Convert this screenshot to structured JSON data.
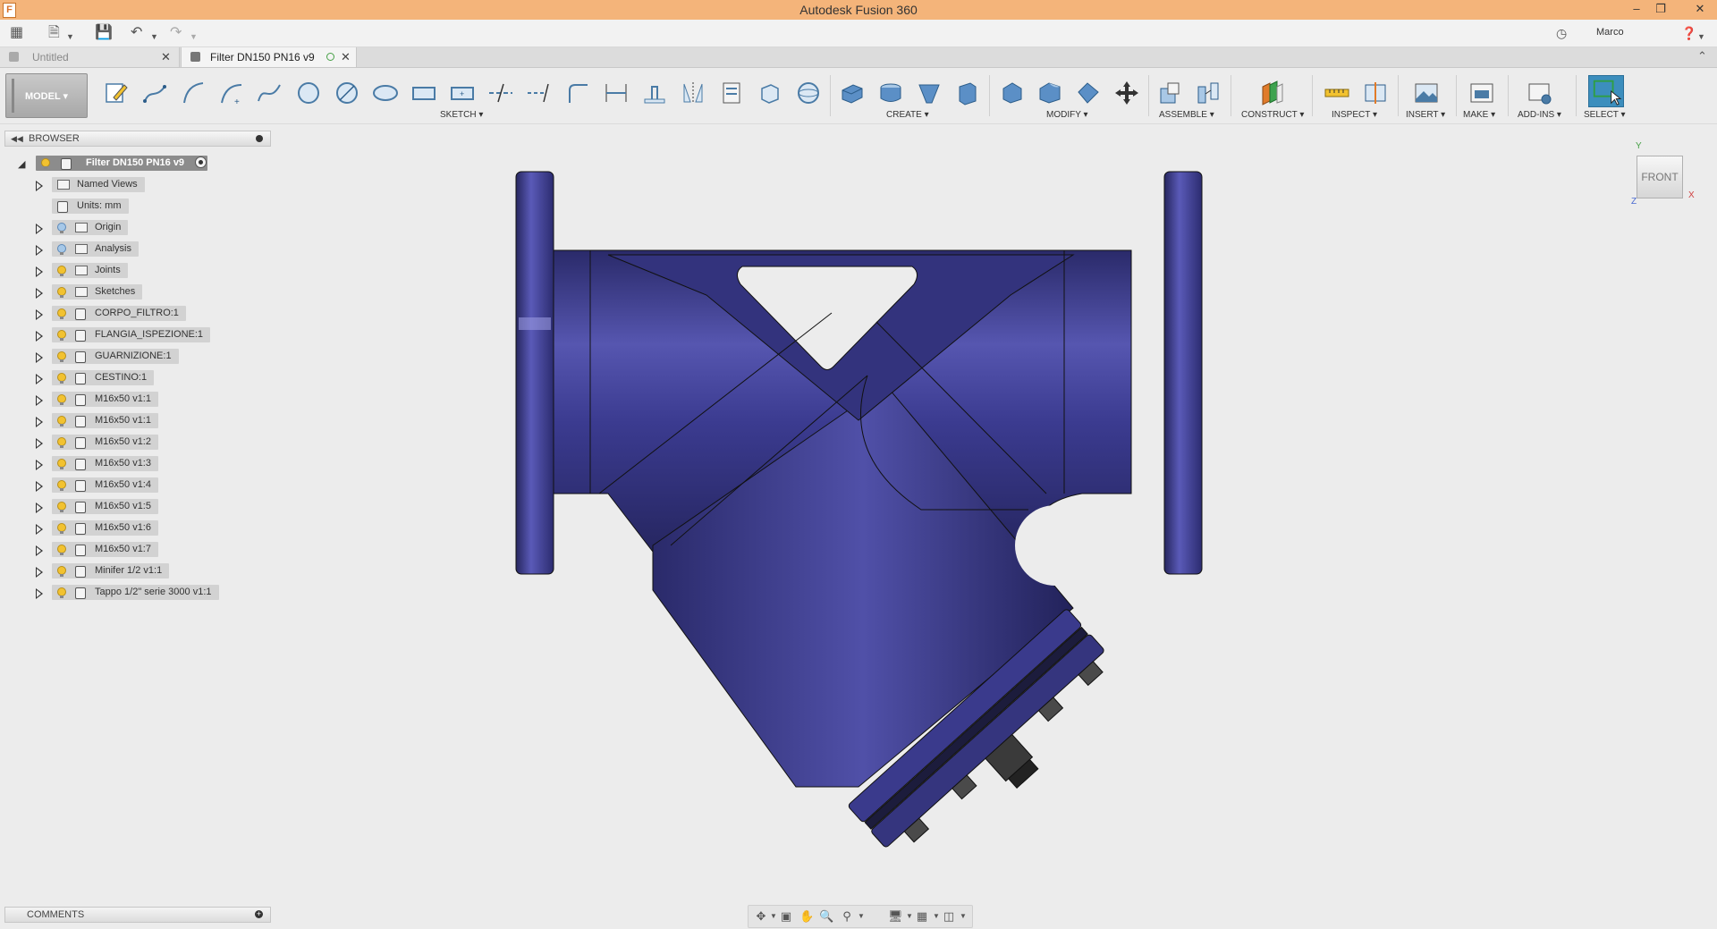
{
  "window": {
    "title": "Autodesk Fusion 360",
    "user": "Marco"
  },
  "tabs": [
    {
      "label": "Untitled",
      "active": false
    },
    {
      "label": "Filter DN150 PN16 v9",
      "active": true
    }
  ],
  "ribbon": {
    "workspace": "MODEL",
    "groups": {
      "sketch": "SKETCH",
      "create": "CREATE",
      "modify": "MODIFY",
      "assemble": "ASSEMBLE",
      "construct": "CONSTRUCT",
      "inspect": "INSPECT",
      "insert": "INSERT",
      "make": "MAKE",
      "addins": "ADD-INS",
      "select": "SELECT"
    }
  },
  "browser": {
    "title": "BROWSER",
    "root": "Filter DN150 PN16 v9",
    "items": [
      {
        "label": "Named Views",
        "type": "folder",
        "bulb": "none",
        "expandable": true
      },
      {
        "label": "Units: mm",
        "type": "doc",
        "bulb": "none",
        "expandable": false
      },
      {
        "label": "Origin",
        "type": "folder",
        "bulb": "blue",
        "expandable": true
      },
      {
        "label": "Analysis",
        "type": "folder",
        "bulb": "blue",
        "expandable": true
      },
      {
        "label": "Joints",
        "type": "folder",
        "bulb": "yellow",
        "expandable": true
      },
      {
        "label": "Sketches",
        "type": "folder",
        "bulb": "yellow",
        "expandable": true
      },
      {
        "label": "CORPO_FILTRO:1",
        "type": "component",
        "bulb": "yellow",
        "expandable": true
      },
      {
        "label": "FLANGIA_ISPEZIONE:1",
        "type": "component",
        "bulb": "yellow",
        "expandable": true
      },
      {
        "label": "GUARNIZIONE:1",
        "type": "component",
        "bulb": "yellow",
        "expandable": true
      },
      {
        "label": "CESTINO:1",
        "type": "component",
        "bulb": "yellow",
        "expandable": true
      },
      {
        "label": "M16x50 v1:1",
        "type": "component",
        "bulb": "yellow",
        "expandable": true
      },
      {
        "label": "M16x50 v1:1",
        "type": "component",
        "bulb": "yellow",
        "expandable": true
      },
      {
        "label": "M16x50 v1:2",
        "type": "component",
        "bulb": "yellow",
        "expandable": true
      },
      {
        "label": "M16x50 v1:3",
        "type": "component",
        "bulb": "yellow",
        "expandable": true
      },
      {
        "label": "M16x50 v1:4",
        "type": "component",
        "bulb": "yellow",
        "expandable": true
      },
      {
        "label": "M16x50 v1:5",
        "type": "component",
        "bulb": "yellow",
        "expandable": true
      },
      {
        "label": "M16x50 v1:6",
        "type": "component",
        "bulb": "yellow",
        "expandable": true
      },
      {
        "label": "M16x50 v1:7",
        "type": "component",
        "bulb": "yellow",
        "expandable": true
      },
      {
        "label": "Minifer 1/2 v1:1",
        "type": "component",
        "bulb": "yellow",
        "expandable": true
      },
      {
        "label": "Tappo 1/2\" serie 3000 v1:1",
        "type": "component",
        "bulb": "yellow",
        "expandable": true
      }
    ]
  },
  "comments": {
    "title": "COMMENTS"
  },
  "viewcube": {
    "face": "FRONT",
    "axis_y": "Y",
    "axis_x": "X",
    "axis_z": "Z"
  },
  "colors": {
    "title_bar": "#f4b47a",
    "model_body": "#3a3a8a",
    "select_accent": "#3c8ebd"
  }
}
